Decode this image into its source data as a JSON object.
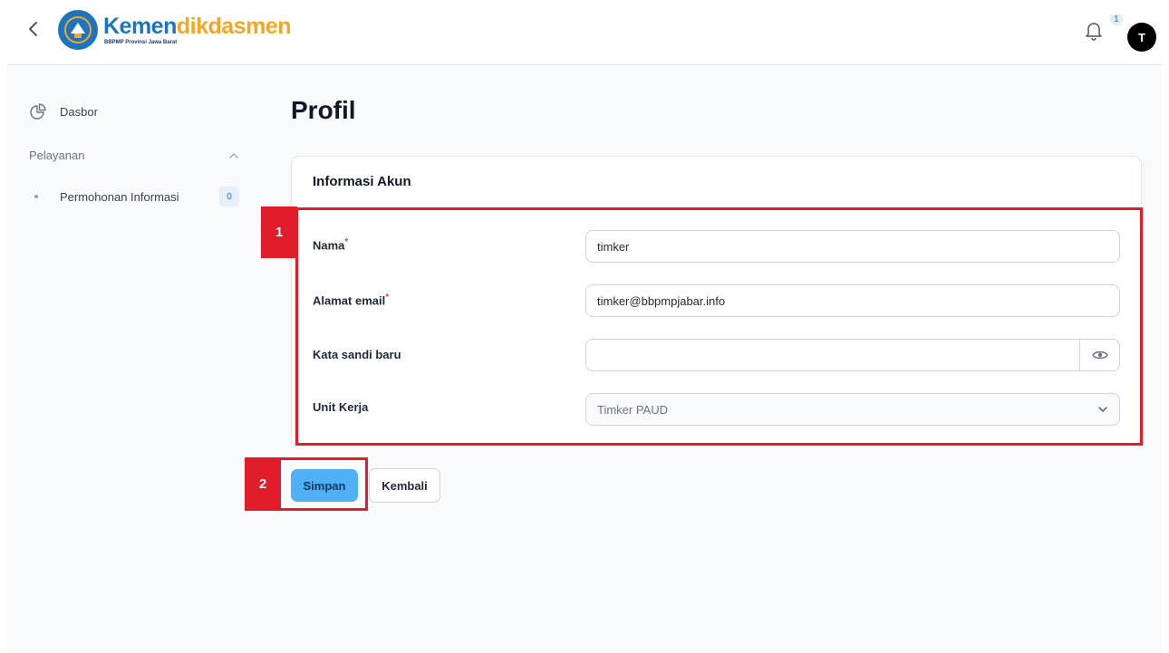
{
  "header": {
    "logo_main_1": "Kemen",
    "logo_main_2": "dikdasmen",
    "logo_sub": "BBPMP Provinsi Jawa Barat",
    "notification_count": "1",
    "avatar_initial": "T"
  },
  "sidebar": {
    "dasbor_label": "Dasbor",
    "section_label": "Pelayanan",
    "items": [
      {
        "label": "Permohonan Informasi",
        "count": "0"
      }
    ]
  },
  "main": {
    "title": "Profil",
    "card_title": "Informasi Akun",
    "fields": {
      "nama": {
        "label": "Nama",
        "value": "timker"
      },
      "email": {
        "label": "Alamat email",
        "value": "timker@bbpmpjabar.info"
      },
      "password": {
        "label": "Kata sandi baru",
        "value": ""
      },
      "unit": {
        "label": "Unit Kerja",
        "value": "Timker PAUD"
      }
    },
    "required_mark": "*",
    "save_label": "Simpan",
    "back_label": "Kembali"
  },
  "annotations": [
    {
      "number": "1"
    },
    {
      "number": "2"
    }
  ],
  "colors": {
    "brand_blue": "#1d75bd",
    "brand_orange": "#f5a623",
    "primary_button": "#4fb0f6",
    "annotation_red": "#e11d2b"
  }
}
